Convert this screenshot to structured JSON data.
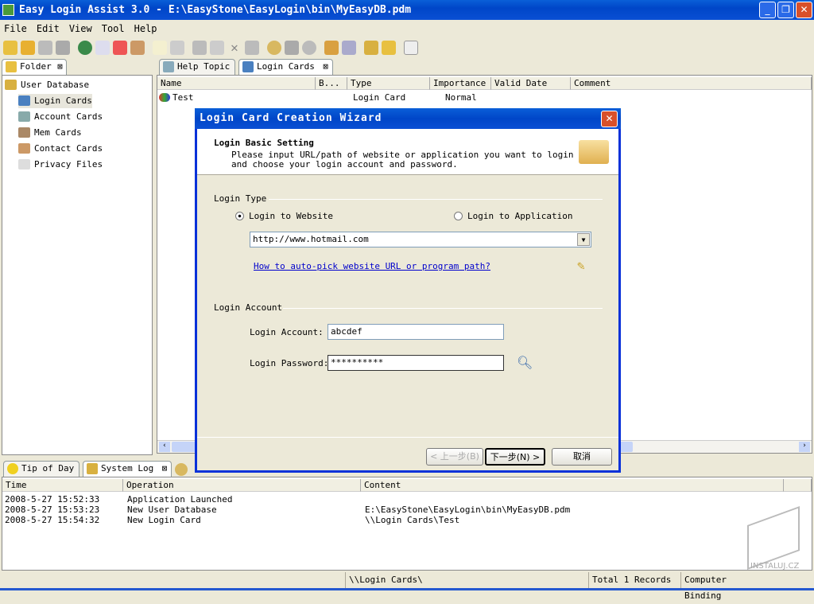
{
  "window": {
    "title": "Easy Login Assist 3.0 - E:\\EasyStone\\EasyLogin\\bin\\MyEasyDB.pdm",
    "min": "_",
    "max": "❐",
    "close": "✕"
  },
  "menu": [
    "File",
    "Edit",
    "View",
    "Tool",
    "Help"
  ],
  "folder_panel": {
    "tab": "Folder",
    "root": "User Database",
    "items": [
      "Login Cards",
      "Account Cards",
      "Mem Cards",
      "Contact Cards",
      "Privacy Files"
    ]
  },
  "main_tabs": [
    "Help Topic",
    "Login Cards"
  ],
  "table": {
    "columns": [
      "Name",
      "B...",
      "Type",
      "Importance",
      "Valid Date",
      "Comment"
    ],
    "rows": [
      {
        "name": "Test",
        "b": "",
        "type": "Login Card",
        "importance": "Normal",
        "valid": "",
        "comment": ""
      }
    ]
  },
  "dialog": {
    "title": "Login Card Creation Wizard",
    "heading": "Login Basic Setting",
    "desc1": "Please input URL/path of website or application you want to login to,",
    "desc2": "and choose your login account and password.",
    "login_type_label": "Login Type",
    "radio_website": "Login to Website",
    "radio_app": "Login to Application",
    "url_value": "http://www.hotmail.com",
    "help_link": "How to auto-pick website URL or program path?",
    "account_group": "Login Account",
    "account_label": "Login Account:",
    "account_value": "abcdef",
    "password_label": "Login Password:",
    "password_value": "**********",
    "back_btn": "< 上一步(B)",
    "next_btn": "下一步(N) >",
    "cancel_btn": "取消"
  },
  "bottom_tabs": [
    "Tip of Day",
    "System Log"
  ],
  "log": {
    "columns": [
      "Time",
      "Operation",
      "Content"
    ],
    "rows": [
      {
        "time": "2008-5-27 15:52:33",
        "op": "Application Launched",
        "content": ""
      },
      {
        "time": "2008-5-27 15:53:23",
        "op": "New User Database",
        "content": "E:\\EasyStone\\EasyLogin\\bin\\MyEasyDB.pdm"
      },
      {
        "time": "2008-5-27 15:54:32",
        "op": "New Login Card",
        "content": "\\\\Login Cards\\Test"
      }
    ]
  },
  "status": {
    "path": "\\\\Login Cards\\",
    "records": "Total 1 Records",
    "binding": "Computer Binding"
  },
  "watermark": "INSTALUJ.CZ"
}
